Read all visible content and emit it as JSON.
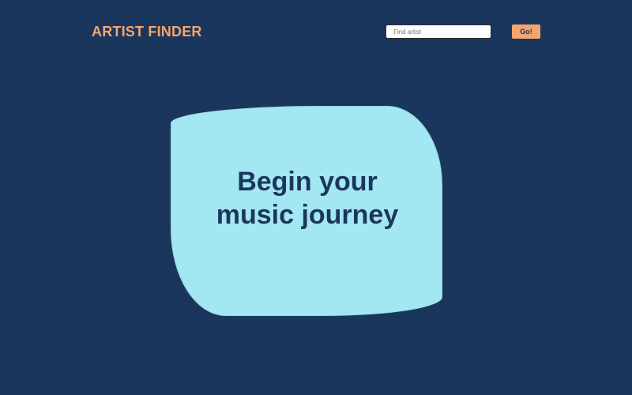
{
  "header": {
    "logo": "ARTIST FINDER",
    "search": {
      "placeholder": "Find artist",
      "value": ""
    },
    "go_button_label": "Go!"
  },
  "hero": {
    "title_line_1": "Begin your",
    "title_line_2": "music journey"
  },
  "colors": {
    "background": "#1b365c",
    "accent": "#f4a56e",
    "card": "#a3e7f2"
  }
}
